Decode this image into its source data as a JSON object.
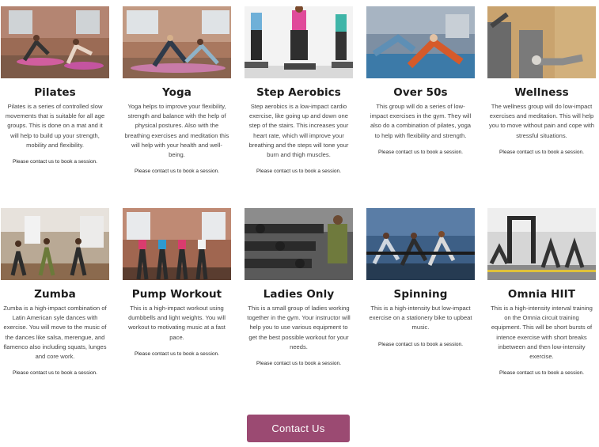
{
  "classes": [
    {
      "title": "Pilates",
      "description": "Pilates is a series of controlled slow movements that is suitable for all age groups. This is done on a mat and it will help to build up your strength, mobility and flexibility.",
      "cta": "Please contact us to book a session."
    },
    {
      "title": "Yoga",
      "description": "Yoga helps to improve your flexibility, strength and balance with the help of physical postures. Also with the breathing exercises and meditation this will help with your health and well-being.",
      "cta": "Please contact us to book a session."
    },
    {
      "title": "Step Aerobics",
      "description": "Step aerobics is a low-impact cardio exercise, like going up and down one step of the stairs. This increases your heart rate, which will improve your breathing and the steps will tone your burn and thigh muscles.",
      "cta": "Please contact us to book a session."
    },
    {
      "title": "Over 50s",
      "description": "This group will do a series of low-impact exercises in the gym. They will also do a combination of pilates, yoga to help with flexibility and strength.",
      "cta": "Please contact us to book a session."
    },
    {
      "title": "Wellness",
      "description": "The wellness group will do low-impact exercises and meditation. This will help you to move without pain and cope with stressful situations.",
      "cta": "Please contact us to book a session."
    },
    {
      "title": "Zumba",
      "description": "Zumba is a high-impact combination of Latin American syle dances with exercise. You will move to the music of the dances like salsa, merengue, and flamenco also including squats, lunges and core work.",
      "cta": "Please contact us to book a session."
    },
    {
      "title": "Pump Workout",
      "description": "This is a high-impact workout using dumbbells and light weights. You will workout to motivating music at a fast pace.",
      "cta": "Please contact us to book a session."
    },
    {
      "title": "Ladies Only",
      "description": "This is a small group of ladies working together in the gym. Your instructor will help you to use various equipment to get the best possible workout for your needs.",
      "cta": "Please contact us to book a session."
    },
    {
      "title": "Spinning",
      "description": "This is a high-intensity but low-impact exercise on a stationery bike to upbeat music.",
      "cta": "Please contact us to book a session."
    },
    {
      "title": "Omnia HIIT",
      "description": "This is a high-intensity interval training on the Omnia circuit training equipment. This will be short bursts of intence exercise with short breaks inbetween and then low-intensity exercise.",
      "cta": "Please contact us to book a session."
    }
  ],
  "contact_button": {
    "label": "Contact Us"
  },
  "colors": {
    "button": "#9b4a72"
  }
}
